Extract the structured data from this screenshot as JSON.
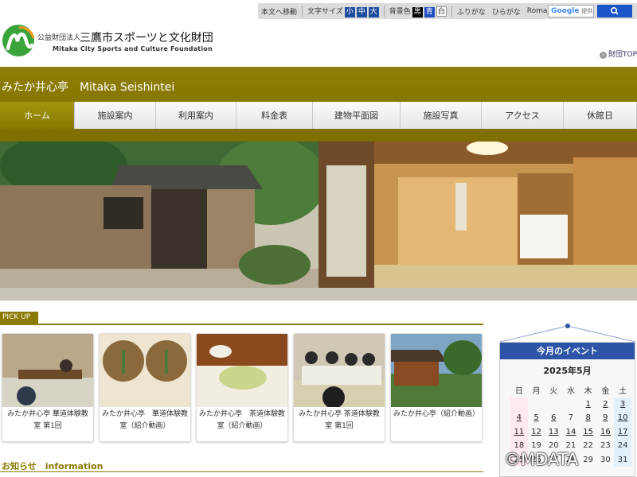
{
  "util": {
    "skip": "本文へ移動",
    "font_size_label": "文字サイズ",
    "sizes": [
      "小",
      "中",
      "大"
    ],
    "bg_label": "背景色",
    "bgs": [
      "黒",
      "青",
      "白"
    ],
    "furigana": "ふりがな",
    "hiragana": "ひらがな",
    "romaji": "Romaji",
    "google": "Google",
    "search_note": "提供"
  },
  "header": {
    "org_prefix": "公益財団法人",
    "org_name": "三鷹市スポーツと文化財団",
    "org_en": "Mitaka City Sports and Culture Foundation",
    "top_link": "財団TOP",
    "site_title": "みたか井心亭　Mitaka Seishintei"
  },
  "nav": [
    "ホーム",
    "施設案内",
    "利用案内",
    "料金表",
    "建物平面図",
    "施設写真",
    "アクセス",
    "休館日"
  ],
  "pickup": {
    "label": "PICK UP",
    "cards": [
      "みたか井心亭 華道体験教室 第1回",
      "みたか井心亭　華道体験教室（紹介動画）",
      "みたか井心亭　茶道体験教室（紹介動画）",
      "みたか井心亭 茶道体験教室 第1回",
      "みたか井心亭（紹介動画）"
    ]
  },
  "info": {
    "title": "お知らせ　information"
  },
  "events": {
    "title": "今月のイベント",
    "month": "2025年5月",
    "weekdays": [
      "日",
      "月",
      "火",
      "水",
      "木",
      "金",
      "土"
    ],
    "weeks": [
      [
        "",
        "",
        "",
        "",
        "1",
        "2",
        "3"
      ],
      [
        "4",
        "5",
        "6",
        "7",
        "8",
        "9",
        "10"
      ],
      [
        "11",
        "12",
        "13",
        "14",
        "15",
        "16",
        "17"
      ],
      [
        "18",
        "19",
        "20",
        "21",
        "22",
        "23",
        "24"
      ],
      [
        "25",
        "26",
        "27",
        "28",
        "29",
        "30",
        "31"
      ]
    ]
  },
  "watermark": "©MDATA"
}
